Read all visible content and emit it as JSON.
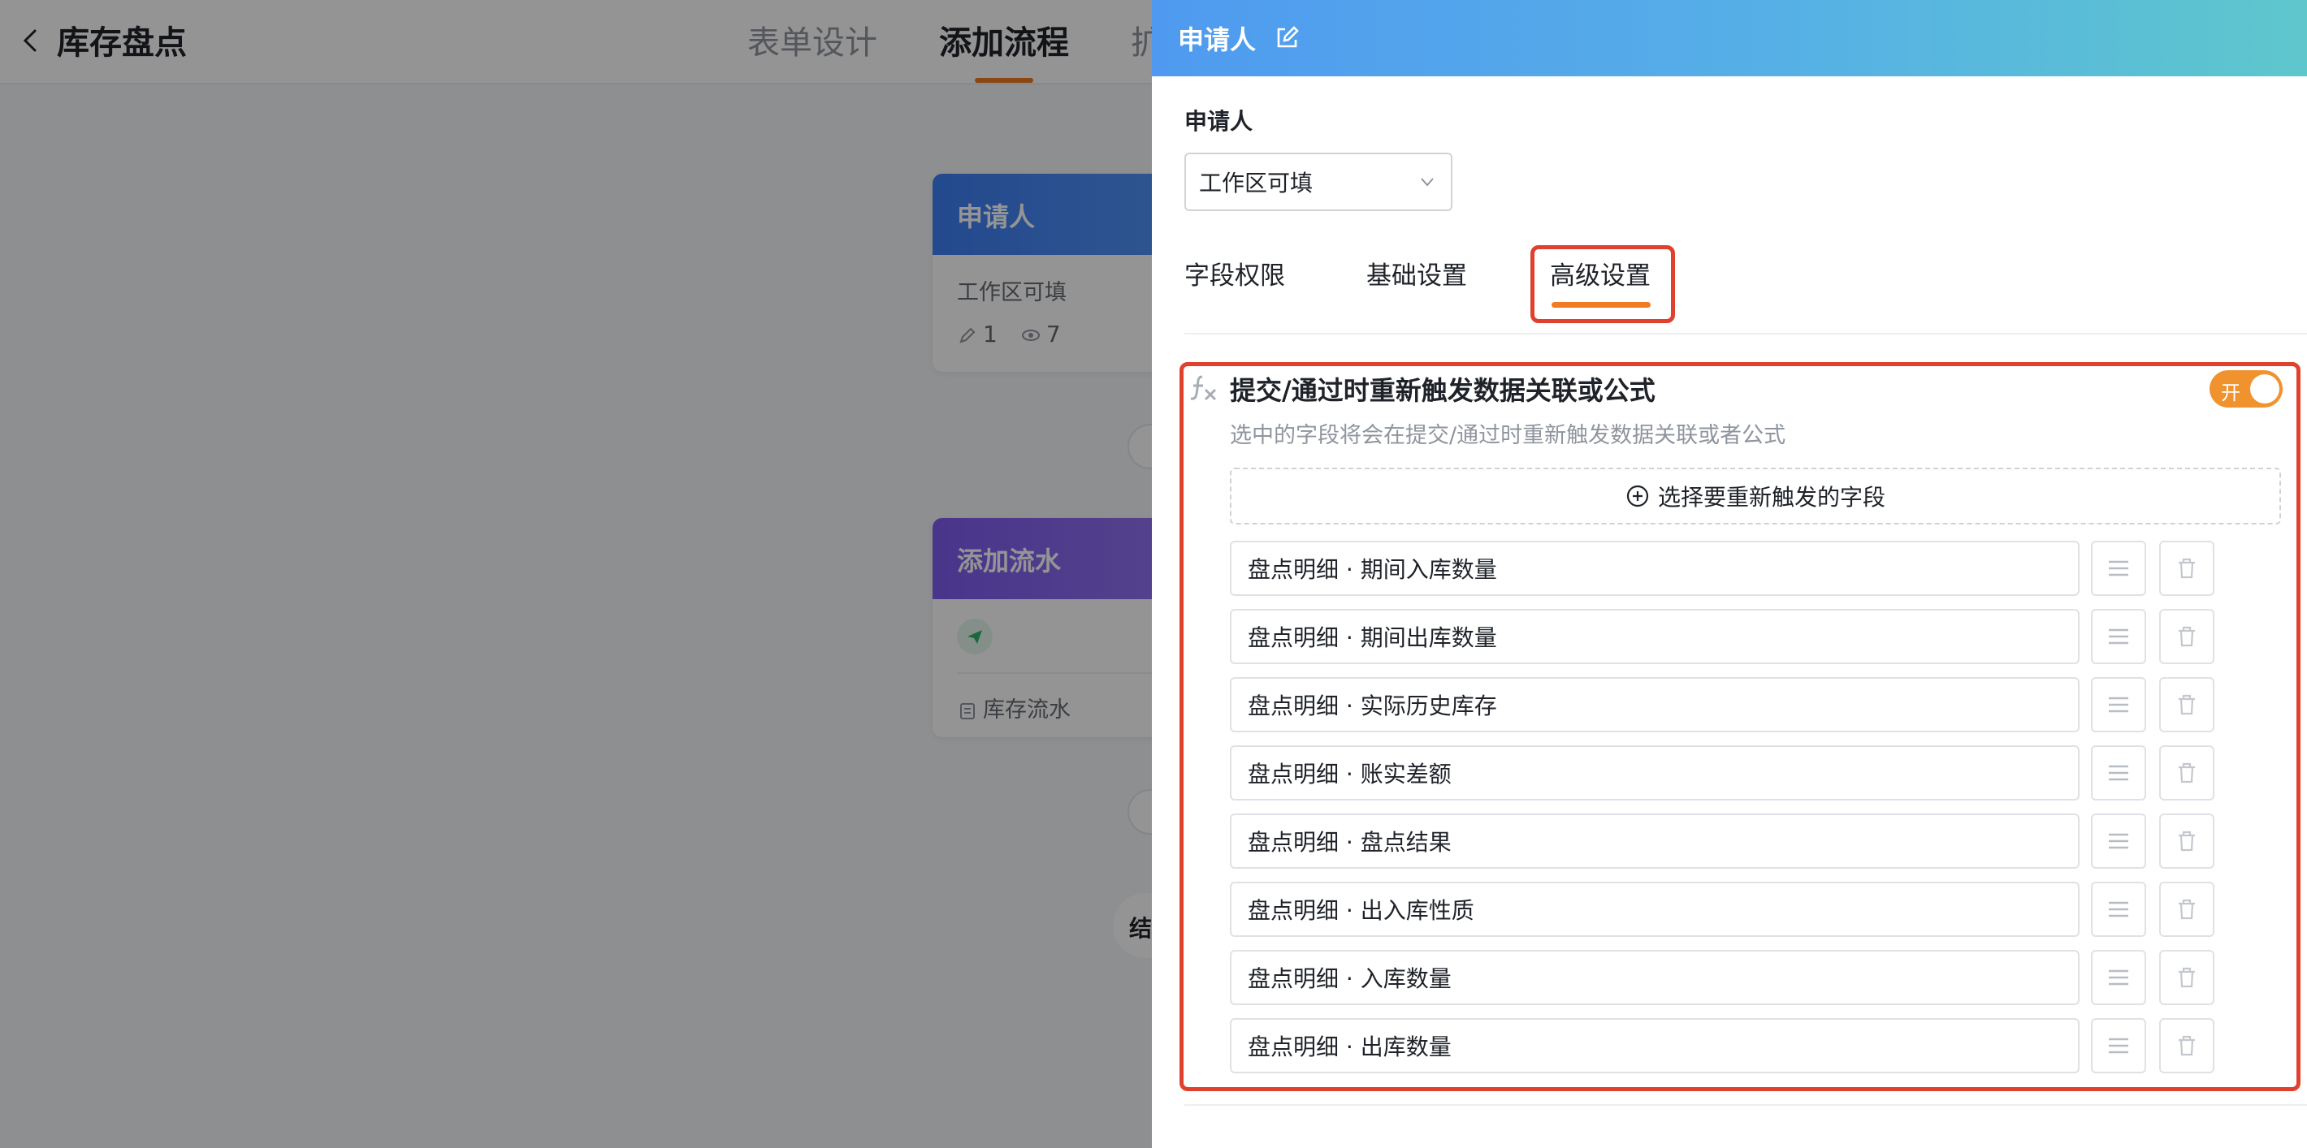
{
  "page": {
    "title": "库存盘点",
    "nav_tabs": [
      "表单设计",
      "添加流程",
      "扩"
    ]
  },
  "flow": {
    "applicant_card": {
      "title": "申请人",
      "permission": "工作区可填",
      "edit_count": "1",
      "view_count": "7"
    },
    "record_card": {
      "title": "添加流水",
      "target": "库存流水"
    },
    "end_label": "结"
  },
  "drawer": {
    "title": "申请人",
    "section_label": "申请人",
    "permission_select": {
      "value": "工作区可填"
    },
    "tabs": [
      "字段权限",
      "基础设置",
      "高级设置"
    ],
    "active_tab": "高级设置",
    "rule": {
      "title": "提交/通过时重新触发数据关联或公式",
      "description": "选中的字段将会在提交/通过时重新触发数据关联或者公式",
      "toggle_label": "开",
      "toggle_on": true,
      "add_button_label": "选择要重新触发的字段",
      "fields": [
        "盘点明细 · 期间入库数量",
        "盘点明细 · 期间出库数量",
        "盘点明细 · 实际历史库存",
        "盘点明细 · 账实差额",
        "盘点明细 · 盘点结果",
        "盘点明细 · 出入库性质",
        "盘点明细 · 入库数量",
        "盘点明细 · 出库数量"
      ]
    }
  },
  "colors": {
    "accent": "#f07b22",
    "highlight": "#e0412f",
    "toggle_on": "#f0922e"
  }
}
